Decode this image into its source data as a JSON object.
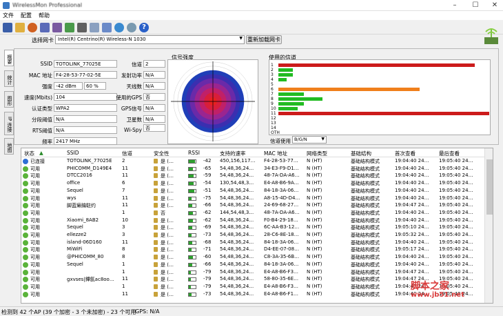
{
  "window": {
    "title": "WirelessMon Professional"
  },
  "menu": [
    "文件",
    "配置",
    "帮助"
  ],
  "adapter": {
    "label": "选择网卡",
    "value": "Intel(R) Centrino(R) Wireless-N 1030",
    "reload_label": "重新加载网卡"
  },
  "tabs": [
    "概要",
    "统计",
    "图形",
    "IP 连接",
    "地图"
  ],
  "summary": {
    "ssid_label": "SSID",
    "ssid": "TOTOLINK_77025E",
    "mac_label": "MAC 地址",
    "mac": "F4-28-53-77-02-5E",
    "strength_label": "强度",
    "strength_dbm": "-42 dBm",
    "strength_pct": "60 %",
    "rate_label": "速度(Mbits)",
    "rate": "104",
    "auth_label": "认证类型",
    "auth": "WPA2",
    "frag_label": "分段阈值",
    "frag": "N/A",
    "rts_label": "RTS阈值",
    "rts": "N/A",
    "freq_label": "频率",
    "freq": "2417 MHz",
    "channel_label": "信道",
    "channel": "2",
    "txpower_label": "发射功率",
    "txpower": "N/A",
    "antenna_label": "天线数",
    "antenna": "N/A",
    "gps_used_label": "使用的GPS",
    "gps_used": "否",
    "gps_signal_label": "GPS信号",
    "gps_signal": "N/A",
    "sats_label": "卫星数",
    "sats": "N/A",
    "wispy_label": "Wi-Spy",
    "wispy": "否"
  },
  "radar": {
    "title": "信号强度"
  },
  "used_channels": {
    "title": "使用的信道",
    "channels": [
      "1",
      "2",
      "3",
      "4",
      "5",
      "6",
      "7",
      "8",
      "9",
      "10",
      "11",
      "12",
      "13",
      "14",
      "OTH"
    ],
    "bars": [
      {
        "channel": "1",
        "value": 0.93,
        "color": "#cc1b1b"
      },
      {
        "channel": "2",
        "value": 0.07,
        "color": "#22bb22"
      },
      {
        "channel": "3",
        "value": 0.07,
        "color": "#22bb22"
      },
      {
        "channel": "4",
        "value": 0.04,
        "color": "#22bb22"
      },
      {
        "channel": "6",
        "value": 0.67,
        "color": "#f07f1b"
      },
      {
        "channel": "7",
        "value": 0.12,
        "color": "#22bb22"
      },
      {
        "channel": "8",
        "value": 0.21,
        "color": "#22bb22"
      },
      {
        "channel": "9",
        "value": 0.12,
        "color": "#22bb22"
      },
      {
        "channel": "10",
        "value": 0.09,
        "color": "#22bb22"
      },
      {
        "channel": "11",
        "value": 1.0,
        "color": "#cc1b1b"
      }
    ],
    "filter_label": "信道使用",
    "filter_value": "B/G/N"
  },
  "list": {
    "columns": [
      "状态",
      "SSID",
      "信道",
      "安全性",
      "RSSI",
      "支持的速率",
      "MAC 地址",
      "网络类型",
      "基础结构",
      "首次查看",
      "最后查看"
    ],
    "rows": [
      {
        "status": "已连接",
        "connected": true,
        "ssid": "TOTOLINK_77025E",
        "ch": "2",
        "sec": "是 (…",
        "rssi": "-42",
        "sig": 0.9,
        "rates": "450,156,117…",
        "mac": "F4-28-53-77…",
        "type": "N (HT)",
        "infra": "基础结构模式",
        "first": "19:04:40 24…",
        "last": "19:05:40 24…"
      },
      {
        "status": "可用",
        "connected": false,
        "ssid": "PHICOMM_D149E4",
        "ch": "11",
        "sec": "是 (…",
        "rssi": "-65",
        "sig": 0.55,
        "rates": "54,48,36,24…",
        "mac": "34-E3-F9-D1…",
        "type": "N (HT)",
        "infra": "基础结构模式",
        "first": "19:04:40 24…",
        "last": "19:05:40 24…"
      },
      {
        "status": "可用",
        "connected": false,
        "ssid": "DTCC2016",
        "ch": "11",
        "sec": "是 (…",
        "rssi": "-59",
        "sig": 0.65,
        "rates": "54,48,36,24…",
        "mac": "48-7A-DA-A6…",
        "type": "N (HT)",
        "infra": "基础结构模式",
        "first": "19:04:40 24…",
        "last": "19:05:40 24…"
      },
      {
        "status": "可用",
        "connected": false,
        "ssid": "office",
        "ch": "6",
        "sec": "是 (…",
        "rssi": "-54",
        "sig": 0.7,
        "rates": "130,54,48,3…",
        "mac": "E4-A8-B6-9A…",
        "type": "N (HT)",
        "infra": "基础结构模式",
        "first": "19:04:40 24…",
        "last": "19:05:40 24…"
      },
      {
        "status": "可用",
        "connected": false,
        "ssid": "Sequel",
        "ch": "7",
        "sec": "是 (…",
        "rssi": "-51",
        "sig": 0.75,
        "rates": "54,48,36,24…",
        "mac": "84-18-3A-06…",
        "type": "N (HT)",
        "infra": "基础结构模式",
        "first": "19:04:40 24…",
        "last": "19:05:40 24…"
      },
      {
        "status": "可用",
        "connected": false,
        "ssid": "wys",
        "ch": "11",
        "sec": "是 (…",
        "rssi": "-75",
        "sig": 0.35,
        "rates": "54,48,36,24…",
        "mac": "A8-15-4D-D4…",
        "type": "N (HT)",
        "infra": "基础结构模式",
        "first": "19:04:40 24…",
        "last": "19:05:40 24…"
      },
      {
        "status": "可用",
        "connected": false,
        "ssid": "脚蓝癞鑰駐约",
        "ch": "11",
        "sec": "是 (…",
        "rssi": "-66",
        "sig": 0.5,
        "rates": "54,48,36,24…",
        "mac": "24-69-68-27…",
        "type": "N (HT)",
        "infra": "基础结构模式",
        "first": "19:04:47 24…",
        "last": "19:05:40 24…"
      },
      {
        "status": "可用",
        "connected": false,
        "ssid": "",
        "ch": "1",
        "sec": "否",
        "rssi": "-62",
        "sig": 0.58,
        "rates": "144,54,48,3…",
        "mac": "48-7A-DA-A6…",
        "type": "N (HT)",
        "infra": "基础结构模式",
        "first": "19:04:40 24…",
        "last": "19:05:40 24…"
      },
      {
        "status": "可用",
        "connected": false,
        "ssid": "Xiaomi_8AB2",
        "ch": "10",
        "sec": "是 (…",
        "rssi": "-62",
        "sig": 0.58,
        "rates": "54,48,36,24…",
        "mac": "F0-B4-29-18…",
        "type": "N (HT)",
        "infra": "基础结构模式",
        "first": "19:04:40 24…",
        "last": "19:05:40 24…"
      },
      {
        "status": "可用",
        "connected": false,
        "ssid": "Sequel",
        "ch": "3",
        "sec": "是 (…",
        "rssi": "-69",
        "sig": 0.45,
        "rates": "54,48,36,24…",
        "mac": "6C-AA-B3-12…",
        "type": "N (HT)",
        "infra": "基础结构模式",
        "first": "19:05:10 24…",
        "last": "19:05:40 24…"
      },
      {
        "status": "可用",
        "connected": false,
        "ssid": "ellezze2",
        "ch": "3",
        "sec": "是 (…",
        "rssi": "-73",
        "sig": 0.4,
        "rates": "54,48,36,24…",
        "mac": "28-C6-8E-18…",
        "type": "N (HT)",
        "infra": "基础结构模式",
        "first": "19:05:32 24…",
        "last": "19:05:40 24…"
      },
      {
        "status": "可用",
        "connected": false,
        "ssid": "island-06D160",
        "ch": "11",
        "sec": "是 (…",
        "rssi": "-68",
        "sig": 0.47,
        "rates": "54,48,36,24…",
        "mac": "84-18-3A-06…",
        "type": "N (HT)",
        "infra": "基础结构模式",
        "first": "19:04:40 24…",
        "last": "19:05:40 24…"
      },
      {
        "status": "可用",
        "connected": false,
        "ssid": "MiWiFi",
        "ch": "8",
        "sec": "是 (…",
        "rssi": "-71",
        "sig": 0.42,
        "rates": "54,48,36,24…",
        "mac": "D4-EE-07-08…",
        "type": "N (HT)",
        "infra": "基础结构模式",
        "first": "19:05:17 24…",
        "last": "19:05:40 24…"
      },
      {
        "status": "可用",
        "connected": false,
        "ssid": "@PHICOMM_80",
        "ch": "8",
        "sec": "是 (…",
        "rssi": "-60",
        "sig": 0.6,
        "rates": "54,48,36,24…",
        "mac": "C8-3A-35-6B…",
        "type": "N (HT)",
        "infra": "基础结构模式",
        "first": "19:04:40 24…",
        "last": "19:05:40 24…"
      },
      {
        "status": "可用",
        "connected": false,
        "ssid": "Sequel",
        "ch": "1",
        "sec": "是 (…",
        "rssi": "-66",
        "sig": 0.5,
        "rates": "54,48,36,24…",
        "mac": "84-18-3A-06…",
        "type": "N (HT)",
        "infra": "基础结构模式",
        "first": "19:04:40 24…",
        "last": "19:05:40 24…"
      },
      {
        "status": "可用",
        "connected": false,
        "ssid": "",
        "ch": "1",
        "sec": "是 (…",
        "rssi": "-79",
        "sig": 0.3,
        "rates": "54,48,36,24…",
        "mac": "E4-A8-B6-F3…",
        "type": "N (HT)",
        "infra": "基础结构模式",
        "first": "19:04:47 24…",
        "last": "19:05:40 24…"
      },
      {
        "status": "可用",
        "connected": false,
        "ssid": "gxvses|鐔氬ac8oo…",
        "ch": "11",
        "sec": "是 (…",
        "rssi": "-79",
        "sig": 0.3,
        "rates": "54,48,36,24…",
        "mac": "58-80-35-6E…",
        "type": "N (HT)",
        "infra": "基础结构模式",
        "first": "19:04:47 24…",
        "last": "19:05:40 24…"
      },
      {
        "status": "可用",
        "connected": false,
        "ssid": "",
        "ch": "1",
        "sec": "是 (…",
        "rssi": "-79",
        "sig": 0.3,
        "rates": "54,48,36,24…",
        "mac": "E4-A8-B6-F3…",
        "type": "N (HT)",
        "infra": "基础结构模式",
        "first": "19:04:47 24…",
        "last": "19:05:40 24…"
      },
      {
        "status": "可用",
        "connected": false,
        "ssid": "",
        "ch": "11",
        "sec": "是 (…",
        "rssi": "-73",
        "sig": 0.4,
        "rates": "54,48,36,24…",
        "mac": "E4-A8-B6-F1…",
        "type": "N (HT)",
        "infra": "基础结构模式",
        "first": "19:04:40 24…",
        "last": "19:05:40 24…"
      }
    ]
  },
  "status": {
    "text": "检测到 42 个AP (39 个加密 - 3 个未加密) - 23 个可用",
    "gps": "GPS: N/A"
  },
  "watermark": {
    "line1": "脚本之家",
    "line2": "www.jb51.net"
  }
}
